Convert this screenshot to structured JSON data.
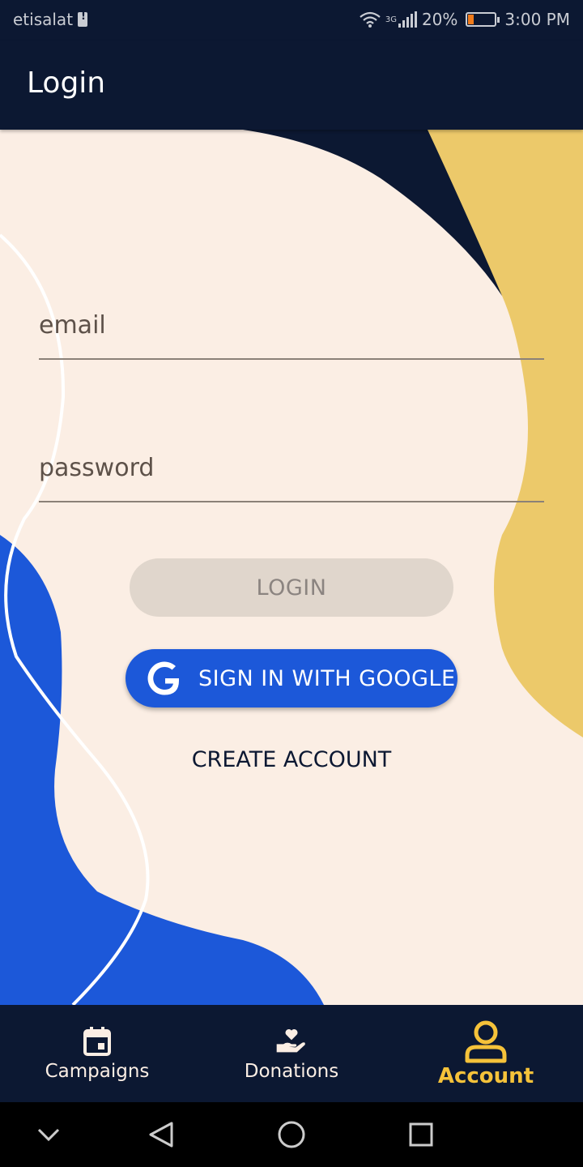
{
  "status_bar": {
    "carrier": "etisalat",
    "network_type": "3G",
    "battery_percent": "20%",
    "time": "3:00 PM"
  },
  "app_bar": {
    "title": "Login"
  },
  "form": {
    "email_placeholder": "email",
    "email_value": "",
    "password_placeholder": "password",
    "password_value": "",
    "login_label": "LOGIN",
    "google_label": "SIGN IN WITH GOOGLE",
    "create_account_label": "CREATE ACCOUNT"
  },
  "bottom_nav": {
    "items": [
      {
        "label": "Campaigns",
        "icon": "calendar-icon",
        "active": false
      },
      {
        "label": "Donations",
        "icon": "hand-heart-icon",
        "active": false
      },
      {
        "label": "Account",
        "icon": "person-icon",
        "active": true
      }
    ]
  },
  "system_nav": {
    "icons": [
      "chevron-down-icon",
      "back-icon",
      "home-icon",
      "recents-icon"
    ]
  },
  "colors": {
    "navy": "#0c1832",
    "cream": "#fbeee4",
    "yellow": "#ecc96a",
    "blue": "#1c58d9",
    "active_nav": "#f5c23a",
    "disabled_button": "#e0d6cc"
  }
}
